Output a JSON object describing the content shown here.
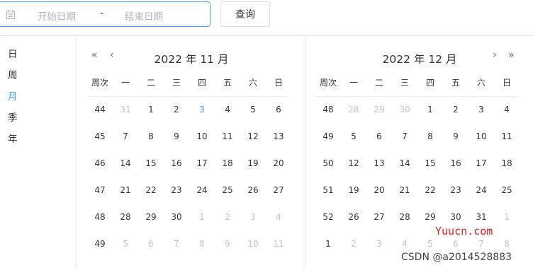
{
  "range": {
    "start_placeholder": "开始日期",
    "separator": "-",
    "end_placeholder": "结束日期",
    "icon": "calendar-icon"
  },
  "query_button": "查询",
  "shortcuts": [
    "日",
    "周",
    "月",
    "季",
    "年"
  ],
  "shortcut_active_index": 2,
  "week_header": [
    "周次",
    "一",
    "二",
    "三",
    "四",
    "五",
    "六",
    "日"
  ],
  "months": [
    {
      "title": "2022 年 11 月",
      "nav_left": [
        "«",
        "‹"
      ],
      "nav_right": [],
      "weeks": [
        {
          "no": "44",
          "days": [
            {
              "d": "31",
              "s": "other"
            },
            {
              "d": "1"
            },
            {
              "d": "2"
            },
            {
              "d": "3",
              "s": "today"
            },
            {
              "d": "4"
            },
            {
              "d": "5"
            },
            {
              "d": "6"
            }
          ]
        },
        {
          "no": "45",
          "days": [
            {
              "d": "7"
            },
            {
              "d": "8"
            },
            {
              "d": "9"
            },
            {
              "d": "10"
            },
            {
              "d": "11"
            },
            {
              "d": "12"
            },
            {
              "d": "13"
            }
          ]
        },
        {
          "no": "46",
          "days": [
            {
              "d": "14"
            },
            {
              "d": "15"
            },
            {
              "d": "16"
            },
            {
              "d": "17"
            },
            {
              "d": "18"
            },
            {
              "d": "19"
            },
            {
              "d": "20"
            }
          ]
        },
        {
          "no": "47",
          "days": [
            {
              "d": "21"
            },
            {
              "d": "22"
            },
            {
              "d": "23"
            },
            {
              "d": "24"
            },
            {
              "d": "25"
            },
            {
              "d": "26"
            },
            {
              "d": "27"
            }
          ]
        },
        {
          "no": "48",
          "days": [
            {
              "d": "28"
            },
            {
              "d": "29"
            },
            {
              "d": "30"
            },
            {
              "d": "1",
              "s": "other"
            },
            {
              "d": "2",
              "s": "other"
            },
            {
              "d": "3",
              "s": "other"
            },
            {
              "d": "4",
              "s": "other"
            }
          ]
        },
        {
          "no": "49",
          "days": [
            {
              "d": "5",
              "s": "other"
            },
            {
              "d": "6",
              "s": "other"
            },
            {
              "d": "7",
              "s": "other"
            },
            {
              "d": "8",
              "s": "other"
            },
            {
              "d": "9",
              "s": "other"
            },
            {
              "d": "10",
              "s": "other"
            },
            {
              "d": "11",
              "s": "other"
            }
          ]
        }
      ]
    },
    {
      "title": "2022 年 12 月",
      "nav_left": [],
      "nav_right": [
        "›",
        "»"
      ],
      "weeks": [
        {
          "no": "48",
          "days": [
            {
              "d": "28",
              "s": "other"
            },
            {
              "d": "29",
              "s": "other"
            },
            {
              "d": "30",
              "s": "other"
            },
            {
              "d": "1"
            },
            {
              "d": "2"
            },
            {
              "d": "3"
            },
            {
              "d": "4"
            }
          ]
        },
        {
          "no": "49",
          "days": [
            {
              "d": "5"
            },
            {
              "d": "6"
            },
            {
              "d": "7"
            },
            {
              "d": "8"
            },
            {
              "d": "9"
            },
            {
              "d": "10"
            },
            {
              "d": "11"
            }
          ]
        },
        {
          "no": "50",
          "days": [
            {
              "d": "12"
            },
            {
              "d": "13"
            },
            {
              "d": "14"
            },
            {
              "d": "15"
            },
            {
              "d": "16"
            },
            {
              "d": "17"
            },
            {
              "d": "18"
            }
          ]
        },
        {
          "no": "51",
          "days": [
            {
              "d": "19"
            },
            {
              "d": "20"
            },
            {
              "d": "21"
            },
            {
              "d": "22"
            },
            {
              "d": "23"
            },
            {
              "d": "24"
            },
            {
              "d": "25"
            }
          ]
        },
        {
          "no": "52",
          "days": [
            {
              "d": "26"
            },
            {
              "d": "27"
            },
            {
              "d": "28"
            },
            {
              "d": "29"
            },
            {
              "d": "30"
            },
            {
              "d": "31"
            },
            {
              "d": "1",
              "s": "other"
            }
          ]
        },
        {
          "no": "1",
          "days": [
            {
              "d": "2",
              "s": "other"
            },
            {
              "d": "3",
              "s": "other"
            },
            {
              "d": "4",
              "s": "other"
            },
            {
              "d": "5",
              "s": "other"
            },
            {
              "d": "6",
              "s": "other"
            },
            {
              "d": "7",
              "s": "other"
            },
            {
              "d": "8",
              "s": "other"
            }
          ]
        }
      ]
    }
  ],
  "watermarks": [
    "Yuucn.com",
    "CSDN @a2014528883"
  ],
  "colors": {
    "accent": "#409eff",
    "muted": "#c0c4cc",
    "watermark": "#e02020"
  }
}
